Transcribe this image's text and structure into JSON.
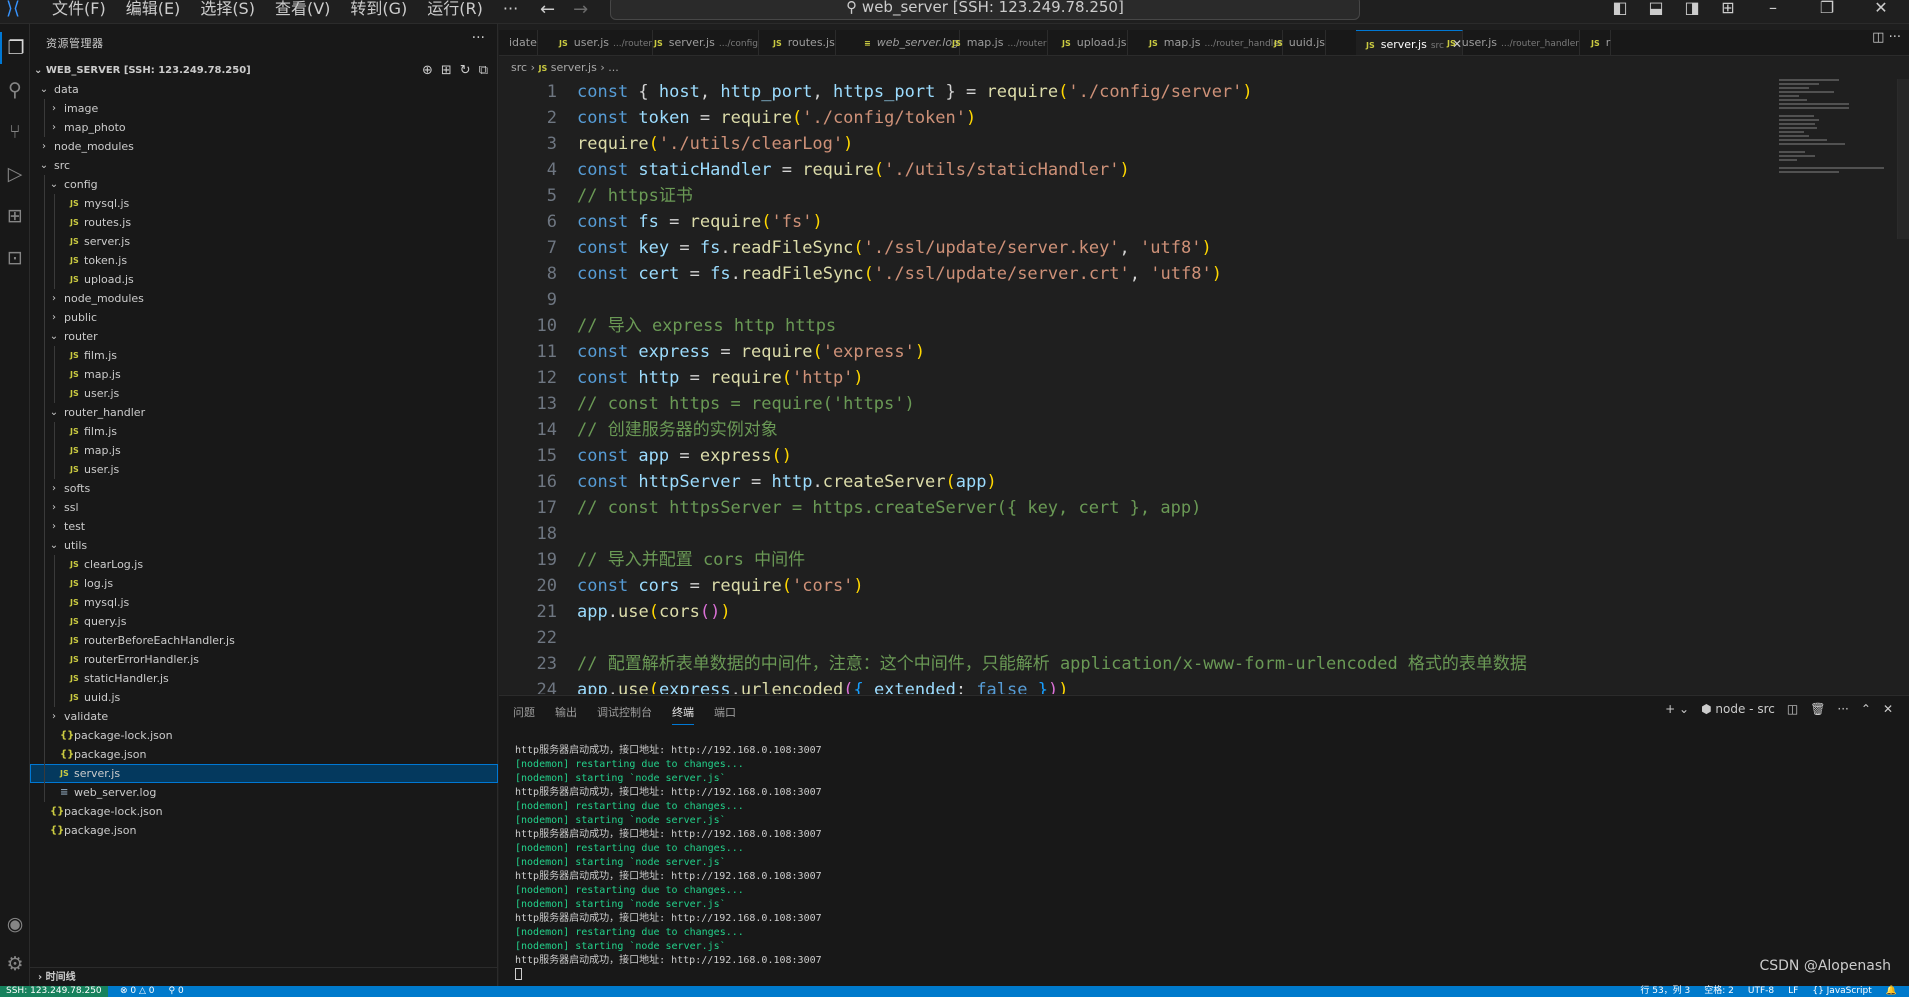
{
  "menu": [
    "文件(F)",
    "编辑(E)",
    "选择(S)",
    "查看(V)",
    "转到(G)",
    "运行(R)",
    "···"
  ],
  "search_text": "web_server [SSH: 123.249.78.250]",
  "sidebar": {
    "title": "资源管理器",
    "root": "WEB_SERVER [SSH: 123.249.78.250]",
    "timeline": "时间线",
    "tree": [
      {
        "label": "data",
        "depth": 0,
        "type": "folder",
        "open": true
      },
      {
        "label": "image",
        "depth": 1,
        "type": "folder",
        "open": false
      },
      {
        "label": "map_photo",
        "depth": 1,
        "type": "folder",
        "open": false
      },
      {
        "label": "node_modules",
        "depth": 0,
        "type": "folder",
        "open": false
      },
      {
        "label": "src",
        "depth": 0,
        "type": "folder",
        "open": true
      },
      {
        "label": "config",
        "depth": 1,
        "type": "folder",
        "open": true
      },
      {
        "label": "mysql.js",
        "depth": 2,
        "type": "js"
      },
      {
        "label": "routes.js",
        "depth": 2,
        "type": "js"
      },
      {
        "label": "server.js",
        "depth": 2,
        "type": "js"
      },
      {
        "label": "token.js",
        "depth": 2,
        "type": "js"
      },
      {
        "label": "upload.js",
        "depth": 2,
        "type": "js"
      },
      {
        "label": "node_modules",
        "depth": 1,
        "type": "folder",
        "open": false
      },
      {
        "label": "public",
        "depth": 1,
        "type": "folder",
        "open": false
      },
      {
        "label": "router",
        "depth": 1,
        "type": "folder",
        "open": true
      },
      {
        "label": "film.js",
        "depth": 2,
        "type": "js"
      },
      {
        "label": "map.js",
        "depth": 2,
        "type": "js"
      },
      {
        "label": "user.js",
        "depth": 2,
        "type": "js"
      },
      {
        "label": "router_handler",
        "depth": 1,
        "type": "folder",
        "open": true
      },
      {
        "label": "film.js",
        "depth": 2,
        "type": "js"
      },
      {
        "label": "map.js",
        "depth": 2,
        "type": "js"
      },
      {
        "label": "user.js",
        "depth": 2,
        "type": "js"
      },
      {
        "label": "softs",
        "depth": 1,
        "type": "folder",
        "open": false
      },
      {
        "label": "ssl",
        "depth": 1,
        "type": "folder",
        "open": false
      },
      {
        "label": "test",
        "depth": 1,
        "type": "folder",
        "open": false
      },
      {
        "label": "utils",
        "depth": 1,
        "type": "folder",
        "open": true
      },
      {
        "label": "clearLog.js",
        "depth": 2,
        "type": "js"
      },
      {
        "label": "log.js",
        "depth": 2,
        "type": "js"
      },
      {
        "label": "mysql.js",
        "depth": 2,
        "type": "js"
      },
      {
        "label": "query.js",
        "depth": 2,
        "type": "js"
      },
      {
        "label": "routerBeforeEachHandler.js",
        "depth": 2,
        "type": "js"
      },
      {
        "label": "routerErrorHandler.js",
        "depth": 2,
        "type": "js"
      },
      {
        "label": "staticHandler.js",
        "depth": 2,
        "type": "js"
      },
      {
        "label": "uuid.js",
        "depth": 2,
        "type": "js"
      },
      {
        "label": "validate",
        "depth": 1,
        "type": "folder",
        "open": false
      },
      {
        "label": "package-lock.json",
        "depth": 1,
        "type": "json"
      },
      {
        "label": "package.json",
        "depth": 1,
        "type": "json"
      },
      {
        "label": "server.js",
        "depth": 1,
        "type": "js",
        "selected": true
      },
      {
        "label": "web_server.log",
        "depth": 1,
        "type": "log"
      },
      {
        "label": "package-lock.json",
        "depth": 0,
        "type": "json"
      },
      {
        "label": "package.json",
        "depth": 0,
        "type": "json"
      }
    ]
  },
  "tabs": [
    {
      "label": "idate",
      "desc": "",
      "icon": ""
    },
    {
      "label": "user.js",
      "desc": ".../router",
      "icon": "JS"
    },
    {
      "label": "server.js",
      "desc": ".../config",
      "icon": "JS"
    },
    {
      "label": "routes.js",
      "desc": "",
      "icon": "JS"
    },
    {
      "label": "web_server.log",
      "desc": "",
      "icon": "≡"
    },
    {
      "label": "map.js",
      "desc": ".../router",
      "icon": "JS"
    },
    {
      "label": "upload.js",
      "desc": "",
      "icon": "JS"
    },
    {
      "label": "map.js",
      "desc": ".../router_handler",
      "icon": "JS"
    },
    {
      "label": "uuid.js",
      "desc": "",
      "icon": "JS"
    },
    {
      "label": "server.js",
      "desc": "src",
      "icon": "JS",
      "active": true
    },
    {
      "label": "user.js",
      "desc": ".../router_handler",
      "icon": "JS"
    },
    {
      "label": "r",
      "desc": "",
      "icon": "JS"
    }
  ],
  "breadcrumb": {
    "folder": "src",
    "file": "server.js",
    "tail": "..."
  },
  "code_lines": [
    [
      [
        "k",
        "const "
      ],
      [
        "p",
        "{ "
      ],
      [
        "v",
        "host"
      ],
      [
        "p",
        ", "
      ],
      [
        "v",
        "http_port"
      ],
      [
        "p",
        ", "
      ],
      [
        "v",
        "https_port"
      ],
      [
        "p",
        " } = "
      ],
      [
        "f",
        "require"
      ],
      [
        "y",
        "("
      ],
      [
        "s",
        "'./config/server'"
      ],
      [
        "y",
        ")"
      ]
    ],
    [
      [
        "k",
        "const "
      ],
      [
        "v",
        "token"
      ],
      [
        "p",
        " = "
      ],
      [
        "f",
        "require"
      ],
      [
        "y",
        "("
      ],
      [
        "s",
        "'./config/token'"
      ],
      [
        "y",
        ")"
      ]
    ],
    [
      [
        "f",
        "require"
      ],
      [
        "y",
        "("
      ],
      [
        "s",
        "'./utils/clearLog'"
      ],
      [
        "y",
        ")"
      ]
    ],
    [
      [
        "k",
        "const "
      ],
      [
        "v",
        "staticHandler"
      ],
      [
        "p",
        " = "
      ],
      [
        "f",
        "require"
      ],
      [
        "y",
        "("
      ],
      [
        "s",
        "'./utils/staticHandler'"
      ],
      [
        "y",
        ")"
      ]
    ],
    [
      [
        "c",
        "// https证书"
      ]
    ],
    [
      [
        "k",
        "const "
      ],
      [
        "v",
        "fs"
      ],
      [
        "p",
        " = "
      ],
      [
        "f",
        "require"
      ],
      [
        "y",
        "("
      ],
      [
        "s",
        "'fs'"
      ],
      [
        "y",
        ")"
      ]
    ],
    [
      [
        "k",
        "const "
      ],
      [
        "v",
        "key"
      ],
      [
        "p",
        " = "
      ],
      [
        "v",
        "fs"
      ],
      [
        "p",
        "."
      ],
      [
        "f",
        "readFileSync"
      ],
      [
        "y",
        "("
      ],
      [
        "s",
        "'./ssl/update/server.key'"
      ],
      [
        "p",
        ", "
      ],
      [
        "s",
        "'utf8'"
      ],
      [
        "y",
        ")"
      ]
    ],
    [
      [
        "k",
        "const "
      ],
      [
        "v",
        "cert"
      ],
      [
        "p",
        " = "
      ],
      [
        "v",
        "fs"
      ],
      [
        "p",
        "."
      ],
      [
        "f",
        "readFileSync"
      ],
      [
        "y",
        "("
      ],
      [
        "s",
        "'./ssl/update/server.crt'"
      ],
      [
        "p",
        ", "
      ],
      [
        "s",
        "'utf8'"
      ],
      [
        "y",
        ")"
      ]
    ],
    [],
    [
      [
        "c",
        "// 导入 express http https"
      ]
    ],
    [
      [
        "k",
        "const "
      ],
      [
        "v",
        "express"
      ],
      [
        "p",
        " = "
      ],
      [
        "f",
        "require"
      ],
      [
        "y",
        "("
      ],
      [
        "s",
        "'express'"
      ],
      [
        "y",
        ")"
      ]
    ],
    [
      [
        "k",
        "const "
      ],
      [
        "v",
        "http"
      ],
      [
        "p",
        " = "
      ],
      [
        "f",
        "require"
      ],
      [
        "y",
        "("
      ],
      [
        "s",
        "'http'"
      ],
      [
        "y",
        ")"
      ]
    ],
    [
      [
        "c",
        "// const https = require('https')"
      ]
    ],
    [
      [
        "c",
        "// 创建服务器的实例对象"
      ]
    ],
    [
      [
        "k",
        "const "
      ],
      [
        "v",
        "app"
      ],
      [
        "p",
        " = "
      ],
      [
        "f",
        "express"
      ],
      [
        "y",
        "()"
      ]
    ],
    [
      [
        "k",
        "const "
      ],
      [
        "v",
        "httpServer"
      ],
      [
        "p",
        " = "
      ],
      [
        "v",
        "http"
      ],
      [
        "p",
        "."
      ],
      [
        "f",
        "createServer"
      ],
      [
        "y",
        "("
      ],
      [
        "v",
        "app"
      ],
      [
        "y",
        ")"
      ]
    ],
    [
      [
        "c",
        "// const httpsServer = https.createServer({ key, cert }, app)"
      ]
    ],
    [],
    [
      [
        "c",
        "// 导入并配置 cors 中间件"
      ]
    ],
    [
      [
        "k",
        "const "
      ],
      [
        "v",
        "cors"
      ],
      [
        "p",
        " = "
      ],
      [
        "f",
        "require"
      ],
      [
        "y",
        "("
      ],
      [
        "s",
        "'cors'"
      ],
      [
        "y",
        ")"
      ]
    ],
    [
      [
        "v",
        "app"
      ],
      [
        "p",
        "."
      ],
      [
        "f",
        "use"
      ],
      [
        "y",
        "("
      ],
      [
        "f",
        "cors"
      ],
      [
        "m",
        "()"
      ],
      [
        "y",
        ")"
      ]
    ],
    [],
    [
      [
        "c",
        "// 配置解析表单数据的中间件，注意：这个中间件，只能解析 application/x-www-form-urlencoded 格式的表单数据"
      ]
    ],
    [
      [
        "v",
        "app"
      ],
      [
        "p",
        "."
      ],
      [
        "f",
        "use"
      ],
      [
        "y",
        "("
      ],
      [
        "v",
        "express"
      ],
      [
        "p",
        "."
      ],
      [
        "f",
        "urlencoded"
      ],
      [
        "m",
        "("
      ],
      [
        "b",
        "{ "
      ],
      [
        "v",
        "extended"
      ],
      [
        "p",
        ": "
      ],
      [
        "k",
        "false"
      ],
      [
        "b",
        " }"
      ],
      [
        "m",
        ")"
      ],
      [
        "y",
        ")"
      ]
    ]
  ],
  "panel": {
    "tabs": [
      "问题",
      "输出",
      "调试控制台",
      "终端",
      "端口"
    ],
    "active_tab": "终端",
    "terminal_label": "node - src",
    "lines": [
      {
        "t": "http服务器启动成功，接口地址: http://192.168.0.108:3007",
        "g": false
      },
      {
        "t": "[nodemon] restarting due to changes...",
        "g": true
      },
      {
        "t": "[nodemon] starting `node server.js`",
        "g": true
      },
      {
        "t": "http服务器启动成功，接口地址: http://192.168.0.108:3007",
        "g": false
      },
      {
        "t": "[nodemon] restarting due to changes...",
        "g": true
      },
      {
        "t": "[nodemon] starting `node server.js`",
        "g": true
      },
      {
        "t": "http服务器启动成功，接口地址: http://192.168.0.108:3007",
        "g": false
      },
      {
        "t": "[nodemon] restarting due to changes...",
        "g": true
      },
      {
        "t": "[nodemon] starting `node server.js`",
        "g": true
      },
      {
        "t": "http服务器启动成功，接口地址: http://192.168.0.108:3007",
        "g": false
      },
      {
        "t": "[nodemon] restarting due to changes...",
        "g": true
      },
      {
        "t": "[nodemon] starting `node server.js`",
        "g": true
      },
      {
        "t": "http服务器启动成功，接口地址: http://192.168.0.108:3007",
        "g": false
      },
      {
        "t": "[nodemon] restarting due to changes...",
        "g": true
      },
      {
        "t": "[nodemon] starting `node server.js`",
        "g": true
      },
      {
        "t": "http服务器启动成功，接口地址: http://192.168.0.108:3007",
        "g": false
      }
    ]
  },
  "watermark": "CSDN @Alopenash",
  "status": {
    "remote": "SSH: 123.249.78.250",
    "problems": "⊗ 0 △ 0",
    "ports": "⚲ 0",
    "position": "行 53，列 3",
    "spaces": "空格: 2",
    "encoding": "UTF-8",
    "eol": "LF",
    "language": "{} JavaScript"
  }
}
